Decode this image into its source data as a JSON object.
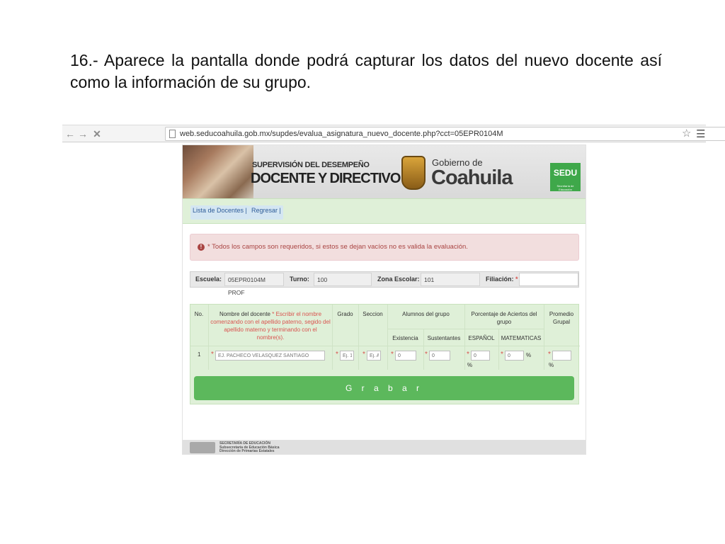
{
  "slide": {
    "text": "16.- Aparece la pantalla donde podrá capturar los datos del nuevo docente así como la información de su grupo."
  },
  "browser": {
    "back_icon": "arrow-left-icon",
    "forward_icon": "arrow-right-icon",
    "close_icon": "close-icon",
    "url": "web.seducoahuila.gob.mx/supdes/evalua_asignatura_nuevo_docente.php?cct=05EPR0104M"
  },
  "banner": {
    "title_line1": "SUPERVISIÓN DEL DESEMPEÑO",
    "title_line2": "DOCENTE Y DIRECTIVO",
    "gobierno": "Gobierno de",
    "state": "Coahuila",
    "sedu": "SEDU",
    "sedu_sub": "Secretaría de Educación"
  },
  "nav": {
    "lista": "Lista de Docentes |",
    "regresar": "Regresar |"
  },
  "alert": {
    "text": "* Todos los campos son requeridos, si estos se dejan vacíos no es valida la evaluación."
  },
  "info": {
    "escuela_label": "Escuela:",
    "escuela_value": "05EPR0104M PROF",
    "turno_label": "Turno:",
    "turno_value": "100",
    "zona_label": "Zona Escolar:",
    "zona_value": "101",
    "filiacion_label": "Filiación:",
    "filiacion_req": "*"
  },
  "table": {
    "headers": {
      "no": "No.",
      "nombre": "Nombre del docente",
      "nombre_note": "* Escribir el nombre comenzando con el apellido paterno, segido del apellido materno y terminando con el nombre(s).",
      "grado": "Grado",
      "seccion": "Seccion",
      "alumnos": "Alumnos del grupo",
      "existencia": "Existencia",
      "sustentantes": "Sustentantes",
      "porcentaje": "Porcentaje de Aciertos del grupo",
      "espanol": "ESPAÑOL",
      "matematicas": "MATEMATICAS",
      "promedio": "Promedio Grupal"
    },
    "row": {
      "no": "1",
      "req": "*",
      "nombre_placeholder": "EJ. PACHECO VELASQUEZ SANTIAGO",
      "grado_placeholder": "Ej. 1",
      "seccion_placeholder": "Ej. A",
      "existencia_value": "0",
      "sustentantes_value": "0",
      "espanol_value": "0",
      "matematicas_value": "0",
      "pct": "%"
    }
  },
  "save_label": "G r a b a r",
  "footer": {
    "line1": "SECRETARÍA DE EDUCACIÓN",
    "line2": "Subsecretaría de Educación Básica",
    "line3": "Dirección de Primarias Estatales"
  }
}
